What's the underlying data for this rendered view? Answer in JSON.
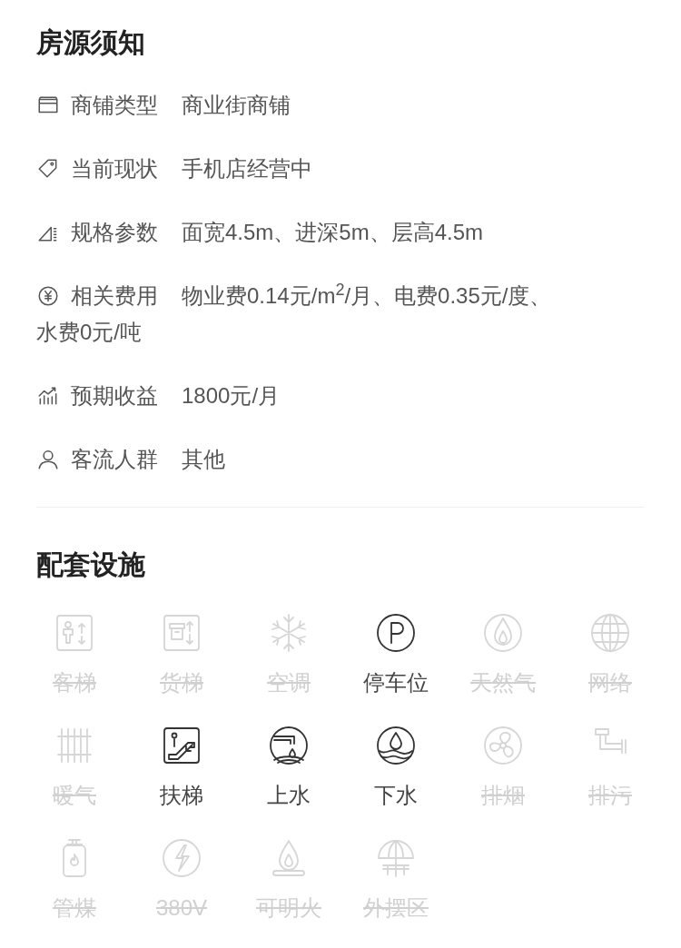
{
  "notice": {
    "title": "房源须知",
    "rows": [
      {
        "kind": "shop",
        "label": "商铺类型",
        "value": "商业街商铺"
      },
      {
        "kind": "tag",
        "label": "当前现状",
        "value": "手机店经营中"
      },
      {
        "kind": "size",
        "label": "规格参数",
        "value": "面宽4.5m、进深5m、层高4.5m"
      },
      {
        "kind": "fee",
        "label": "相关费用",
        "value": "物业费0.14元/m$^{2}$/月、电费0.35元/度、",
        "continued": "水费0元/吨"
      },
      {
        "kind": "income",
        "label": "预期收益",
        "value": "1800元/月"
      },
      {
        "kind": "person",
        "label": "客流人群",
        "value": "其他"
      }
    ]
  },
  "facilities": {
    "title": "配套设施",
    "items": [
      {
        "kind": "elevator",
        "label": "客梯",
        "available": false
      },
      {
        "kind": "freight",
        "label": "货梯",
        "available": false
      },
      {
        "kind": "ac",
        "label": "空调",
        "available": false
      },
      {
        "kind": "parking",
        "label": "停车位",
        "available": true
      },
      {
        "kind": "gas",
        "label": "天然气",
        "available": false
      },
      {
        "kind": "network",
        "label": "网络",
        "available": false
      },
      {
        "kind": "heating",
        "label": "暖气",
        "available": false
      },
      {
        "kind": "escalator",
        "label": "扶梯",
        "available": true
      },
      {
        "kind": "water_in",
        "label": "上水",
        "available": true
      },
      {
        "kind": "water_out",
        "label": "下水",
        "available": true
      },
      {
        "kind": "smoke",
        "label": "排烟",
        "available": false
      },
      {
        "kind": "sewage",
        "label": "排污",
        "available": false
      },
      {
        "kind": "coal",
        "label": "管煤",
        "available": false
      },
      {
        "kind": "power",
        "label": "380V",
        "available": false
      },
      {
        "kind": "fire",
        "label": "可明火",
        "available": false
      },
      {
        "kind": "outdoor",
        "label": "外摆区",
        "available": false
      }
    ]
  }
}
